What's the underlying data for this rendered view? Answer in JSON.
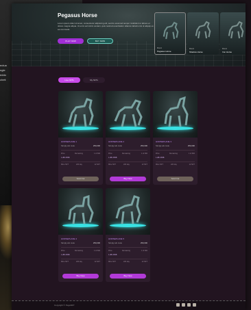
{
  "background": {
    "left_text_lines": [
      "ectua",
      "ngle",
      "eddo",
      "cheti"
    ]
  },
  "hero": {
    "title": "Pegasus Horse",
    "description": "Lorem ipsum dolor sit amet, consectetur adipiscing elit, sed do eiusmod tempor incididunt ut labore et dolore magna aliqua. Ut enim ad minim veniam, quis nostrud exercitation ullamco laboris nisi ut aliquip ex ea commodo.",
    "play_label": "PLAY NOW",
    "buy_label": "BUY NOW",
    "thumbnails": [
      {
        "caption": "Mount",
        "name": "Pegasus Horse",
        "active": true
      },
      {
        "caption": "Mount",
        "name": "Shadow Horse",
        "active": false
      },
      {
        "caption": "Mount",
        "name": "Iron Horse",
        "active": false
      }
    ]
  },
  "tabs": [
    {
      "label": "Live NFTs",
      "active": true
    },
    {
      "label": "My NFTs",
      "active": false
    }
  ],
  "cards": [
    {
      "name": "HORSEPLANE 1",
      "sub": "Simply ark mule",
      "price": "250,000",
      "rows": [
        [
          "Price",
          "Remaining",
          "1 of 600"
        ],
        [
          "1.2Bn BNB",
          ""
        ]
      ],
      "stats": [
        [
          "Mine NFT",
          "220 day",
          "12 NFT"
        ]
      ],
      "cta": "Sold Out",
      "sold": true
    },
    {
      "name": "HORSEPLANE 2",
      "sub": "Simply ark mule",
      "price": "250,000",
      "rows": [
        [
          "Price",
          "Remaining",
          "1 of 600"
        ],
        [
          "1.2Bn BNB",
          ""
        ]
      ],
      "stats": [
        [
          "Mine NFT",
          "220 day",
          "12 NFT"
        ]
      ],
      "cta": "Buy Now",
      "sold": false
    },
    {
      "name": "HORSEPLANE 3",
      "sub": "Simply ark mule",
      "price": "250,000",
      "rows": [
        [
          "Price",
          "Remaining",
          "1 of 600"
        ],
        [
          "1.2Bn BNB",
          ""
        ]
      ],
      "stats": [
        [
          "Mine NFT",
          "220 day",
          "12 NFT"
        ]
      ],
      "cta": "Sold Out",
      "sold": true
    },
    {
      "name": "HORSEPLANE 4",
      "sub": "Simply ark mule",
      "price": "250,000",
      "rows": [
        [
          "Price",
          "Remaining",
          "1 of 600"
        ],
        [
          "1.2Bn BNB",
          ""
        ]
      ],
      "stats": [
        [
          "Mine NFT",
          "220 day",
          "12 NFT"
        ]
      ],
      "cta": "Buy Now",
      "sold": false
    },
    {
      "name": "HORSEPLANE 5",
      "sub": "Simply ark mule",
      "price": "250,000",
      "rows": [
        [
          "Price",
          "Remaining",
          "1 of 600"
        ],
        [
          "1.2Bn BNB",
          ""
        ]
      ],
      "stats": [
        [
          "Mine NFT",
          "220 day",
          "12 NFT"
        ]
      ],
      "cta": "Buy Now",
      "sold": false
    }
  ],
  "footer": {
    "copyright": "Copyright © PegaNFT"
  },
  "colors": {
    "accent": "#c84be8",
    "glow": "#39e2e4"
  }
}
